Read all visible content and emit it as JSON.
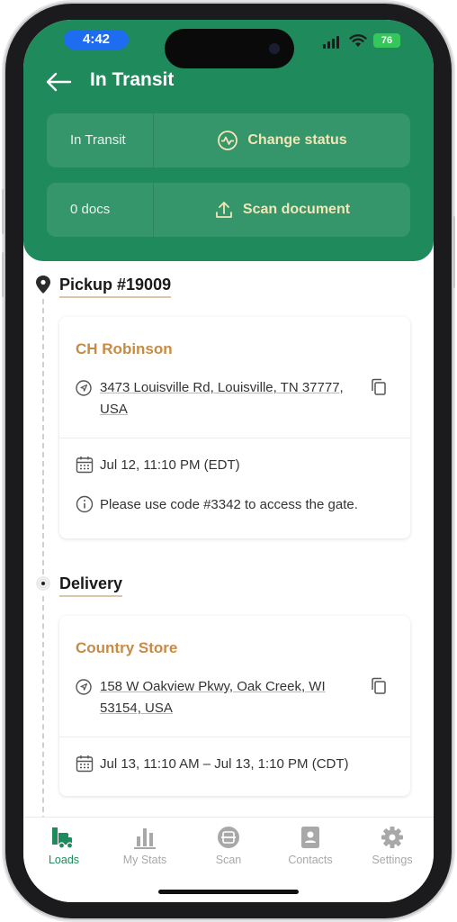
{
  "status_bar": {
    "time": "4:42",
    "battery": "76"
  },
  "header": {
    "title": "In Transit",
    "status_row": {
      "value": "In Transit",
      "action": "Change status"
    },
    "docs_row": {
      "value": "0 docs",
      "action": "Scan document"
    }
  },
  "stops": [
    {
      "title": "Pickup #19009",
      "company": "CH Robinson",
      "address_line1": "3473 Louisville Rd, Louisville, TN 37777,",
      "address_line2": "USA",
      "time": "Jul 12, 11:10 PM (EDT)",
      "note": "Please use code #3342 to access the gate."
    },
    {
      "title": "Delivery",
      "company": "Country Store",
      "address_line1": "158 W Oakview Pkwy, Oak Creek, WI",
      "address_line2": "53154, USA",
      "time": "Jul 13, 11:10 AM – Jul 13, 1:10 PM (CDT)"
    }
  ],
  "tabs": [
    {
      "label": "Loads",
      "icon": "truck-icon",
      "active": true
    },
    {
      "label": "My Stats",
      "icon": "bar-chart-icon",
      "active": false
    },
    {
      "label": "Scan",
      "icon": "scan-icon",
      "active": false
    },
    {
      "label": "Contacts",
      "icon": "contacts-icon",
      "active": false
    },
    {
      "label": "Settings",
      "icon": "gear-icon",
      "active": false
    }
  ],
  "colors": {
    "header_green": "#1f8a5b",
    "action_text": "#f3e6b6",
    "company_text": "#c68b45",
    "active_tab": "#1f8a5b",
    "time_pill": "#1e6cf0"
  }
}
